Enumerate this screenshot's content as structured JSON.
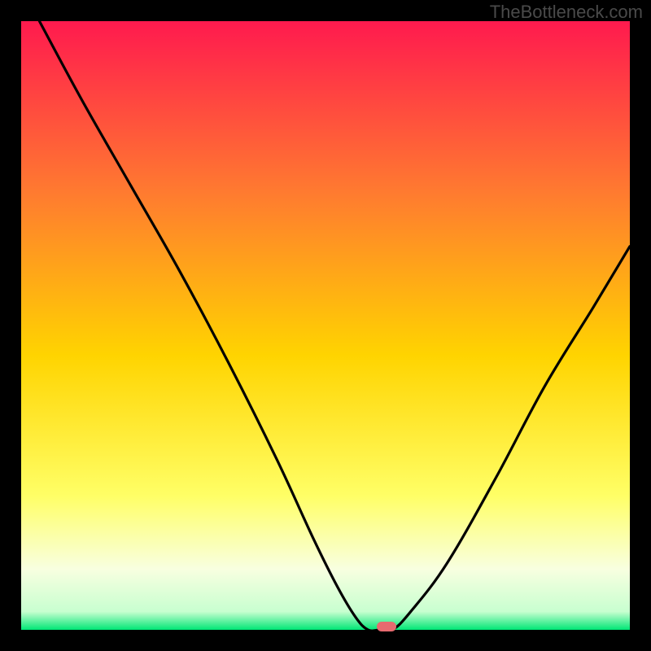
{
  "watermark": "TheBottleneck.com",
  "colors": {
    "black": "#000000",
    "gradient_top": "#ff1a4e",
    "gradient_mid1": "#ff7a30",
    "gradient_mid2": "#ffd400",
    "gradient_mid3": "#ffff66",
    "gradient_pale": "#f8ffe0",
    "gradient_green": "#00e676",
    "marker": "#e76a6f",
    "curve": "#000000"
  },
  "chart_data": {
    "type": "line",
    "title": "",
    "xlabel": "",
    "ylabel": "",
    "ylim": [
      0,
      100
    ],
    "xlim": [
      0,
      100
    ],
    "series": [
      {
        "name": "bottleneck-curve",
        "x": [
          3,
          10,
          18,
          26,
          34,
          42,
          48,
          52,
          55,
          57,
          59,
          61,
          64,
          70,
          78,
          86,
          94,
          100
        ],
        "values": [
          100,
          87,
          73,
          59,
          44,
          28,
          15,
          7,
          2,
          0,
          0,
          0,
          3,
          11,
          25,
          40,
          53,
          63
        ]
      }
    ],
    "marker_point": {
      "x": 60,
      "y": 0
    },
    "gradient_stops": [
      {
        "pct": 0,
        "color": "#ff1a4e"
      },
      {
        "pct": 28,
        "color": "#ff7a30"
      },
      {
        "pct": 55,
        "color": "#ffd400"
      },
      {
        "pct": 78,
        "color": "#ffff66"
      },
      {
        "pct": 90,
        "color": "#f8ffe0"
      },
      {
        "pct": 97,
        "color": "#c8ffd0"
      },
      {
        "pct": 100,
        "color": "#00e676"
      }
    ]
  }
}
